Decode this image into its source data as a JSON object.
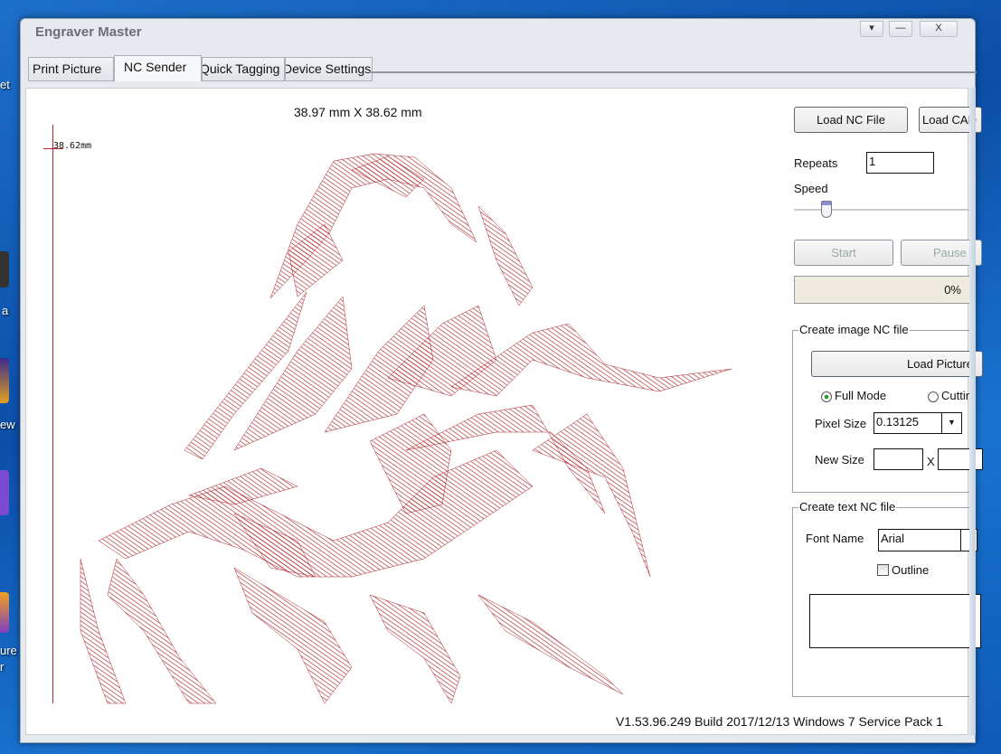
{
  "desktop": {
    "fragments": [
      "et",
      "a",
      "ew",
      "ure",
      "r"
    ]
  },
  "window": {
    "title": "Engraver Master",
    "controls": {
      "menu": "▾",
      "minimize": "—",
      "close": "X"
    }
  },
  "tabs": [
    {
      "label": "Print Picture"
    },
    {
      "label": "NC Sender",
      "active": true
    },
    {
      "label": "Quick Tagging"
    },
    {
      "label": "Device Settings"
    }
  ],
  "canvas": {
    "dimensions": "38.97 mm X 38.62 mm",
    "ruler_label": "38.62mm",
    "drawing_color": "#b0282c"
  },
  "panel": {
    "load_nc_label": "Load NC File",
    "load_cad_label": "Load CAD",
    "repeats_label": "Repeats",
    "repeats_value": "1",
    "speed_label": "Speed",
    "speed_value_fraction": 0.18,
    "start_label": "Start",
    "pause_label": "Pause",
    "progress_text": "0%",
    "progress_value": 0,
    "image_group": {
      "title": "Create image NC file",
      "load_picture_label": "Load Picture",
      "mode_full": "Full Mode",
      "mode_cutting": "Cutting",
      "selected_mode": "Full Mode",
      "pixel_size_label": "Pixel Size",
      "pixel_size_value": "0.13125",
      "new_size_label": "New Size",
      "new_size_x": "X",
      "new_width": "",
      "new_height": ""
    },
    "text_group": {
      "title": "Create text NC file",
      "font_name_label": "Font Name",
      "font_name_value": "Arial",
      "outline_label": "Outline",
      "outline_checked": false,
      "text_value": ""
    }
  },
  "status": {
    "version": "V1.53.96.249 Build 2017/12/13 Windows 7 Service Pack 1"
  }
}
